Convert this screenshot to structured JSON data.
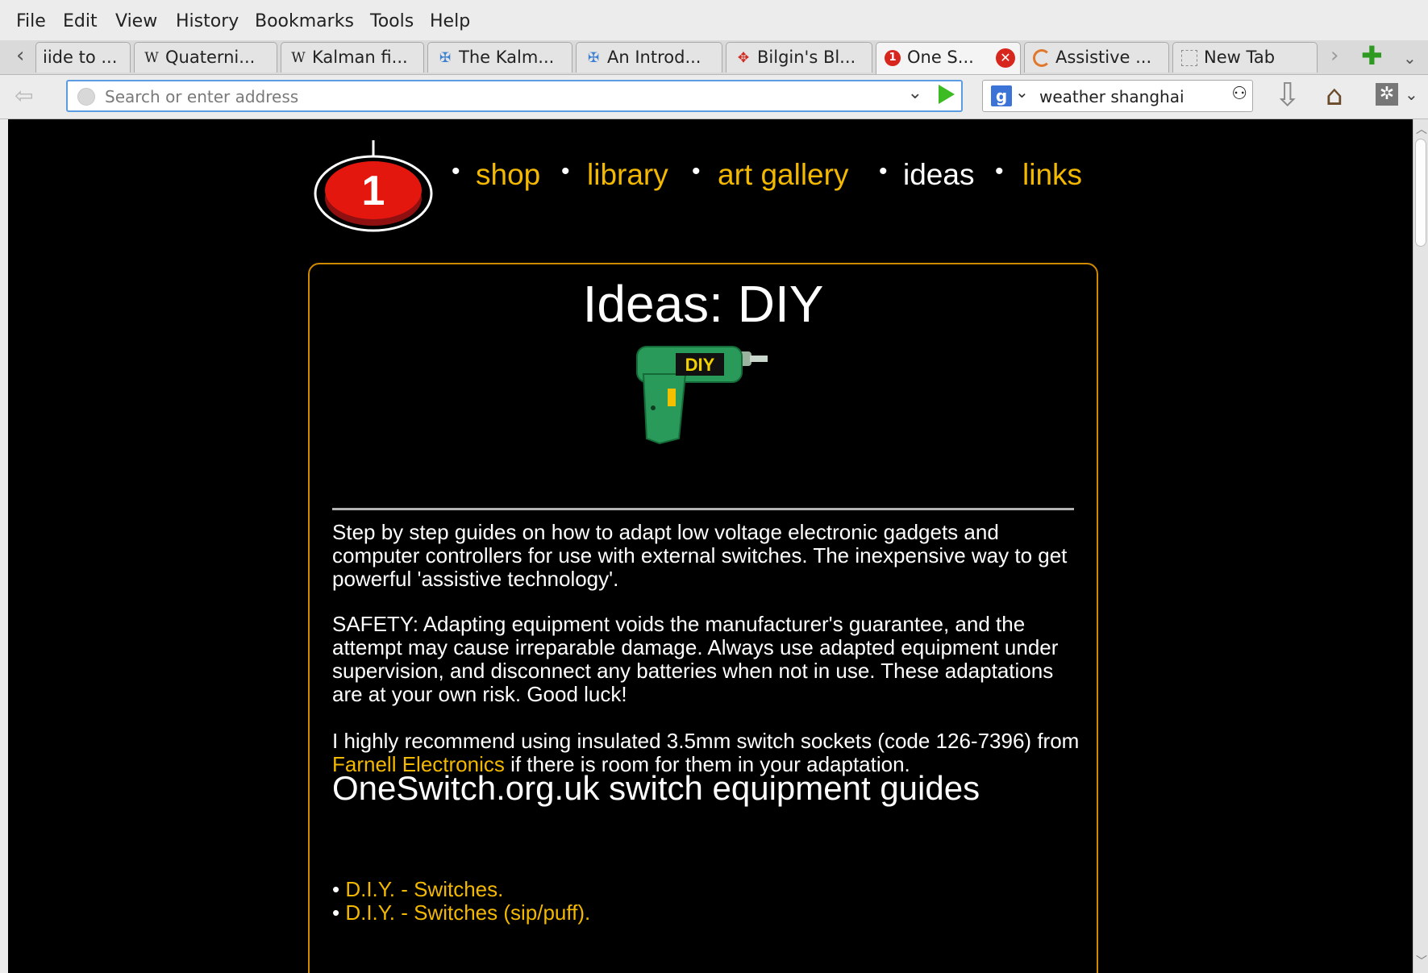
{
  "menubar": {
    "items": [
      "File",
      "Edit",
      "View",
      "History",
      "Bookmarks",
      "Tools",
      "Help"
    ]
  },
  "tabs": [
    {
      "label": "iide to ...",
      "icon": "none"
    },
    {
      "label": "Quaterni...",
      "icon": "wikipedia-icon"
    },
    {
      "label": "Kalman fi...",
      "icon": "wikipedia-icon"
    },
    {
      "label": "The Kalm...",
      "icon": "unc-icon"
    },
    {
      "label": "An Introd...",
      "icon": "unc-icon"
    },
    {
      "label": "Bilgin's Bl...",
      "icon": "blog-icon"
    },
    {
      "label": "One S...",
      "icon": "oneswitch-icon",
      "active": true
    },
    {
      "label": "Assistive ...",
      "icon": "loading-icon"
    },
    {
      "label": "New Tab",
      "icon": "blank-page-icon"
    }
  ],
  "navbar": {
    "url_placeholder": "Search or enter address",
    "search_value": "weather shanghai",
    "search_engine": "g"
  },
  "page": {
    "logo_text": "1",
    "nav": [
      {
        "label": "shop",
        "current": false
      },
      {
        "label": "library",
        "current": false
      },
      {
        "label": "art gallery",
        "current": false
      },
      {
        "label": "ideas",
        "current": true
      },
      {
        "label": "links",
        "current": false
      }
    ],
    "title": "Ideas: DIY",
    "drill_label": "DIY",
    "intro": "Step by step guides on how to adapt low voltage electronic gadgets and computer controllers for use with external switches. The inexpensive way to get powerful 'assistive technology'.",
    "safety": "SAFETY: Adapting equipment voids the manufacturer's guarantee, and the attempt may cause irreparable damage. Always use adapted equipment under supervision, and disconnect any batteries when not in use. These adaptations are at your own risk. Good luck!",
    "recommend_before": "I highly recommend using insulated 3.5mm switch sockets (code 126-7396) from ",
    "recommend_link": "Farnell Electronics",
    "recommend_after": " if there is room for them in your adaptation.",
    "section_heading": "OneSwitch.org.uk switch equipment guides",
    "guides": [
      "D.I.Y. - Switches.",
      "D.I.Y. - Switches (sip/puff)."
    ]
  },
  "colors": {
    "link": "#f3b800",
    "box_border": "#cf8a00",
    "background": "#000000",
    "tab_close": "#d7261e"
  }
}
